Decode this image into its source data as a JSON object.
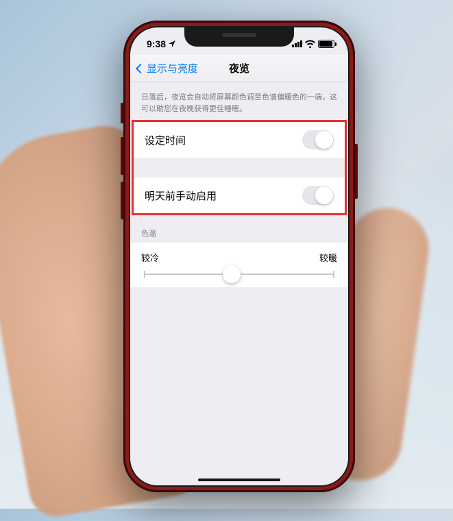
{
  "status": {
    "time": "9:38",
    "location_icon": "location-arrow"
  },
  "nav": {
    "back_label": "显示与亮度",
    "title": "夜览"
  },
  "description": "日落后，夜览会自动将屏幕颜色调至色谱偏暖色的一端，这可以助您在夜晚获得更佳睡眠。",
  "rows": {
    "schedule_label": "设定时间",
    "manual_label": "明天前手动启用"
  },
  "color_temp": {
    "section_label": "色温",
    "cold_label": "较冷",
    "warm_label": "较暖"
  }
}
